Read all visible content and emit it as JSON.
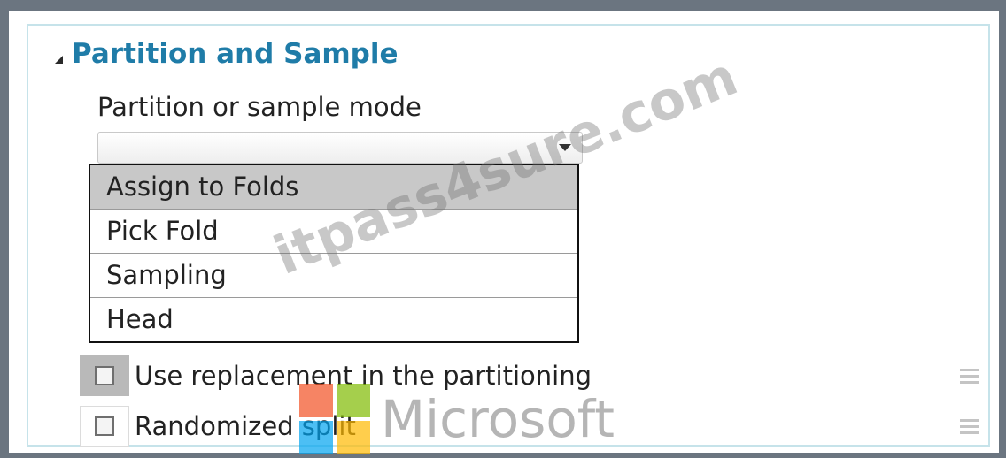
{
  "section": {
    "title": "Partition and Sample"
  },
  "mode": {
    "label": "Partition or sample mode",
    "selected_value": "",
    "options": [
      "Assign to Folds",
      "Pick Fold",
      "Sampling",
      "Head"
    ]
  },
  "checkboxes": [
    {
      "label": "Use replacement in the partitioning",
      "checked": false
    },
    {
      "label": "Randomized split",
      "checked": false
    }
  ],
  "watermark": {
    "site": "itpass4sure.com",
    "brand": "Microsoft"
  },
  "colors": {
    "header": "#1f7ca8",
    "selected_option": "#c8c8c8",
    "panel_border": "#c6e3ea"
  }
}
